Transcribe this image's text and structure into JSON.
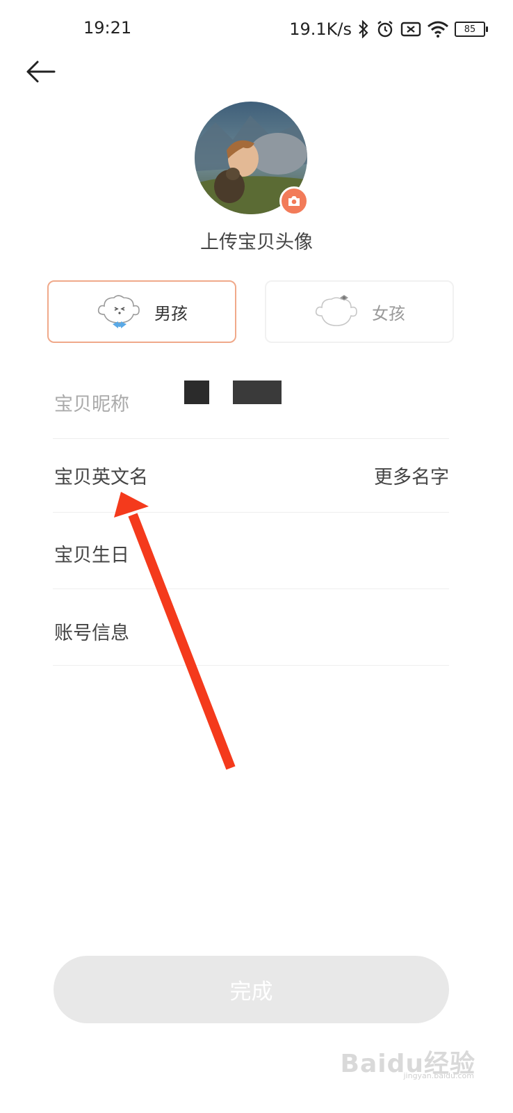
{
  "status_bar": {
    "time": "19:21",
    "speed": "19.1K/s",
    "battery": "85",
    "icons": [
      "bluetooth-icon",
      "alarm-icon",
      "sim-off-icon",
      "wifi-icon",
      "battery-icon"
    ]
  },
  "header": {
    "back_icon": "arrow-left-icon"
  },
  "avatar": {
    "upload_label": "上传宝贝头像",
    "badge_icon": "camera-icon"
  },
  "gender": {
    "boy_label": "男孩",
    "girl_label": "女孩",
    "selected": "boy",
    "selected_border_color": "#f0a98a"
  },
  "form": {
    "nickname_label": "宝贝昵称",
    "english_name_label": "宝贝英文名",
    "more_names_label": "更多名字",
    "birthday_label": "宝贝生日",
    "account_label": "账号信息"
  },
  "annotation": {
    "arrow_color": "#f43a1c"
  },
  "footer": {
    "done_label": "完成",
    "done_bg": "#e8e8e8"
  },
  "watermark": {
    "main": "Baidu经验",
    "sub": "jingyan.baidu.com"
  },
  "colors": {
    "accent": "#f27b59"
  }
}
